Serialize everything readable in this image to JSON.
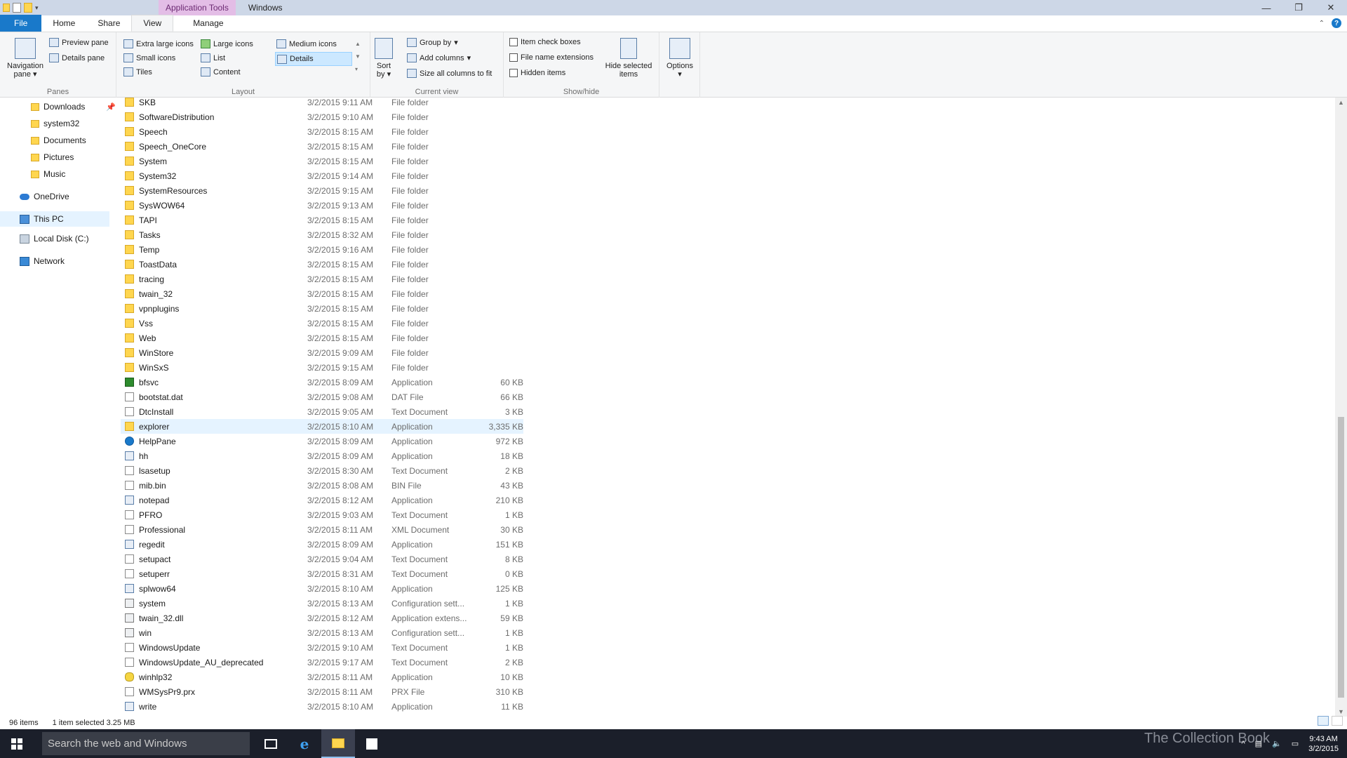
{
  "titlebar": {
    "context_tab": "Application Tools",
    "window_title": "Windows",
    "minimize": "—",
    "restore": "❐",
    "close": "✕"
  },
  "tabs": {
    "file": "File",
    "home": "Home",
    "share": "Share",
    "view": "View",
    "manage": "Manage"
  },
  "ribbon": {
    "panes": {
      "label": "Panes",
      "navigation_pane": "Navigation pane",
      "preview_pane": "Preview pane",
      "details_pane": "Details pane"
    },
    "layout": {
      "label": "Layout",
      "extra_large_icons": "Extra large icons",
      "large_icons": "Large icons",
      "medium_icons": "Medium icons",
      "small_icons": "Small icons",
      "list": "List",
      "details": "Details",
      "tiles": "Tiles",
      "content": "Content"
    },
    "current_view": {
      "label": "Current view",
      "sort_by": "Sort by",
      "group_by": "Group by",
      "add_columns": "Add columns",
      "size_all_columns": "Size all columns to fit"
    },
    "show_hide": {
      "label": "Show/hide",
      "item_check_boxes": "Item check boxes",
      "file_name_extensions": "File name extensions",
      "hidden_items": "Hidden items",
      "hide_selected_items": "Hide selected items"
    },
    "options": "Options"
  },
  "nav": {
    "items": [
      {
        "label": "Downloads",
        "icon": "downloads-icon"
      },
      {
        "label": "system32",
        "icon": "folder-icon"
      },
      {
        "label": "Documents",
        "icon": "documents-icon"
      },
      {
        "label": "Pictures",
        "icon": "pictures-icon"
      },
      {
        "label": "Music",
        "icon": "music-icon"
      },
      {
        "label": "OneDrive",
        "icon": "onedrive-icon"
      },
      {
        "label": "This PC",
        "icon": "computer-icon"
      },
      {
        "label": "Local Disk (C:)",
        "icon": "drive-icon"
      },
      {
        "label": "Network",
        "icon": "network-icon"
      }
    ]
  },
  "files": [
    {
      "name": "SKB",
      "date": "3/2/2015 9:11 AM",
      "type": "File folder",
      "size": "",
      "icon": "folder"
    },
    {
      "name": "SoftwareDistribution",
      "date": "3/2/2015 9:10 AM",
      "type": "File folder",
      "size": "",
      "icon": "folder"
    },
    {
      "name": "Speech",
      "date": "3/2/2015 8:15 AM",
      "type": "File folder",
      "size": "",
      "icon": "folder"
    },
    {
      "name": "Speech_OneCore",
      "date": "3/2/2015 8:15 AM",
      "type": "File folder",
      "size": "",
      "icon": "folder"
    },
    {
      "name": "System",
      "date": "3/2/2015 8:15 AM",
      "type": "File folder",
      "size": "",
      "icon": "folder"
    },
    {
      "name": "System32",
      "date": "3/2/2015 9:14 AM",
      "type": "File folder",
      "size": "",
      "icon": "folder"
    },
    {
      "name": "SystemResources",
      "date": "3/2/2015 9:15 AM",
      "type": "File folder",
      "size": "",
      "icon": "folder"
    },
    {
      "name": "SysWOW64",
      "date": "3/2/2015 9:13 AM",
      "type": "File folder",
      "size": "",
      "icon": "folder"
    },
    {
      "name": "TAPI",
      "date": "3/2/2015 8:15 AM",
      "type": "File folder",
      "size": "",
      "icon": "folder"
    },
    {
      "name": "Tasks",
      "date": "3/2/2015 8:32 AM",
      "type": "File folder",
      "size": "",
      "icon": "folder"
    },
    {
      "name": "Temp",
      "date": "3/2/2015 9:16 AM",
      "type": "File folder",
      "size": "",
      "icon": "folder"
    },
    {
      "name": "ToastData",
      "date": "3/2/2015 8:15 AM",
      "type": "File folder",
      "size": "",
      "icon": "folder"
    },
    {
      "name": "tracing",
      "date": "3/2/2015 8:15 AM",
      "type": "File folder",
      "size": "",
      "icon": "folder"
    },
    {
      "name": "twain_32",
      "date": "3/2/2015 8:15 AM",
      "type": "File folder",
      "size": "",
      "icon": "folder"
    },
    {
      "name": "vpnplugins",
      "date": "3/2/2015 8:15 AM",
      "type": "File folder",
      "size": "",
      "icon": "folder"
    },
    {
      "name": "Vss",
      "date": "3/2/2015 8:15 AM",
      "type": "File folder",
      "size": "",
      "icon": "folder"
    },
    {
      "name": "Web",
      "date": "3/2/2015 8:15 AM",
      "type": "File folder",
      "size": "",
      "icon": "folder"
    },
    {
      "name": "WinStore",
      "date": "3/2/2015 9:09 AM",
      "type": "File folder",
      "size": "",
      "icon": "folder"
    },
    {
      "name": "WinSxS",
      "date": "3/2/2015 9:15 AM",
      "type": "File folder",
      "size": "",
      "icon": "folder"
    },
    {
      "name": "bfsvc",
      "date": "3/2/2015 8:09 AM",
      "type": "Application",
      "size": "60 KB",
      "icon": "bfsvc"
    },
    {
      "name": "bootstat.dat",
      "date": "3/2/2015 9:08 AM",
      "type": "DAT File",
      "size": "66 KB",
      "icon": "doc"
    },
    {
      "name": "DtcInstall",
      "date": "3/2/2015 9:05 AM",
      "type": "Text Document",
      "size": "3 KB",
      "icon": "doc"
    },
    {
      "name": "explorer",
      "date": "3/2/2015 8:10 AM",
      "type": "Application",
      "size": "3,335 KB",
      "icon": "folder",
      "selected": true
    },
    {
      "name": "HelpPane",
      "date": "3/2/2015 8:09 AM",
      "type": "Application",
      "size": "972 KB",
      "icon": "help"
    },
    {
      "name": "hh",
      "date": "3/2/2015 8:09 AM",
      "type": "Application",
      "size": "18 KB",
      "icon": "app"
    },
    {
      "name": "lsasetup",
      "date": "3/2/2015 8:30 AM",
      "type": "Text Document",
      "size": "2 KB",
      "icon": "doc"
    },
    {
      "name": "mib.bin",
      "date": "3/2/2015 8:08 AM",
      "type": "BIN File",
      "size": "43 KB",
      "icon": "doc"
    },
    {
      "name": "notepad",
      "date": "3/2/2015 8:12 AM",
      "type": "Application",
      "size": "210 KB",
      "icon": "app"
    },
    {
      "name": "PFRO",
      "date": "3/2/2015 9:03 AM",
      "type": "Text Document",
      "size": "1 KB",
      "icon": "doc"
    },
    {
      "name": "Professional",
      "date": "3/2/2015 8:11 AM",
      "type": "XML Document",
      "size": "30 KB",
      "icon": "doc"
    },
    {
      "name": "regedit",
      "date": "3/2/2015 8:09 AM",
      "type": "Application",
      "size": "151 KB",
      "icon": "app"
    },
    {
      "name": "setupact",
      "date": "3/2/2015 9:04 AM",
      "type": "Text Document",
      "size": "8 KB",
      "icon": "doc"
    },
    {
      "name": "setuperr",
      "date": "3/2/2015 8:31 AM",
      "type": "Text Document",
      "size": "0 KB",
      "icon": "doc"
    },
    {
      "name": "splwow64",
      "date": "3/2/2015 8:10 AM",
      "type": "Application",
      "size": "125 KB",
      "icon": "app"
    },
    {
      "name": "system",
      "date": "3/2/2015 8:13 AM",
      "type": "Configuration sett...",
      "size": "1 KB",
      "icon": "config"
    },
    {
      "name": "twain_32.dll",
      "date": "3/2/2015 8:12 AM",
      "type": "Application extens...",
      "size": "59 KB",
      "icon": "config"
    },
    {
      "name": "win",
      "date": "3/2/2015 8:13 AM",
      "type": "Configuration sett...",
      "size": "1 KB",
      "icon": "config"
    },
    {
      "name": "WindowsUpdate",
      "date": "3/2/2015 9:10 AM",
      "type": "Text Document",
      "size": "1 KB",
      "icon": "doc"
    },
    {
      "name": "WindowsUpdate_AU_deprecated",
      "date": "3/2/2015 9:17 AM",
      "type": "Text Document",
      "size": "2 KB",
      "icon": "doc"
    },
    {
      "name": "winhlp32",
      "date": "3/2/2015 8:11 AM",
      "type": "Application",
      "size": "10 KB",
      "icon": "yellow"
    },
    {
      "name": "WMSysPr9.prx",
      "date": "3/2/2015 8:11 AM",
      "type": "PRX File",
      "size": "310 KB",
      "icon": "doc"
    },
    {
      "name": "write",
      "date": "3/2/2015 8:10 AM",
      "type": "Application",
      "size": "11 KB",
      "icon": "app"
    }
  ],
  "status": {
    "items": "96 items",
    "selected": "1 item selected  3.25 MB"
  },
  "taskbar": {
    "search_placeholder": "Search the web and Windows",
    "time": "9:43 AM",
    "date": "3/2/2015",
    "watermark": "The Collection Book"
  }
}
